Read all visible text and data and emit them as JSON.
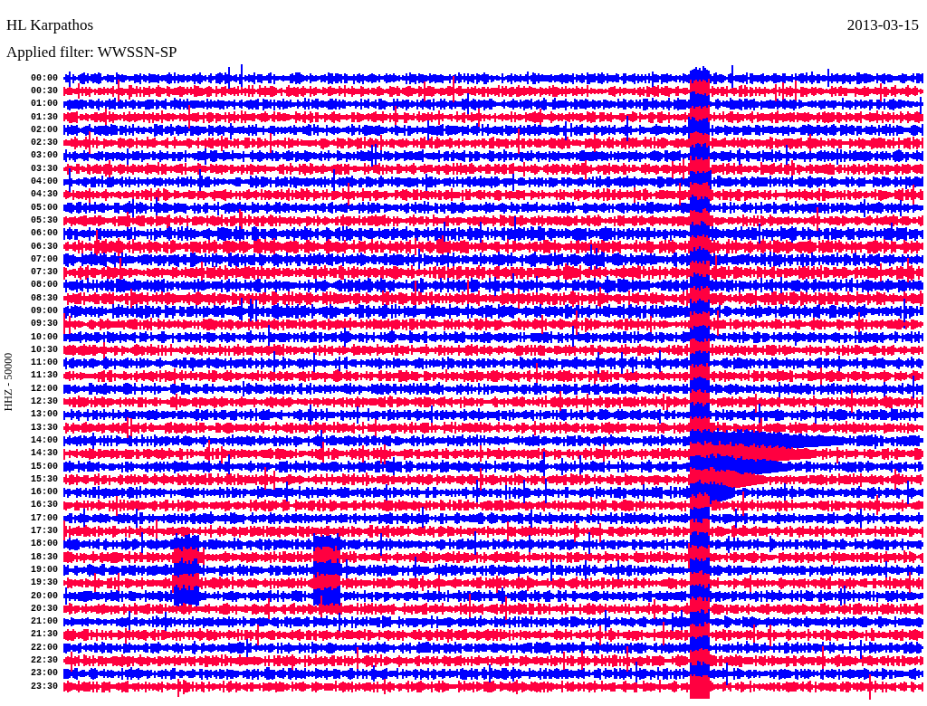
{
  "header": {
    "station": "HL Karpathos",
    "date": "2013-03-15",
    "filter": "Applied filter: WWSSN-SP"
  },
  "axis_label": "HHZ - 50000",
  "rows": [
    {
      "time": "00:00",
      "color": "#0000ff"
    },
    {
      "time": "00:30",
      "color": "#ff0040"
    },
    {
      "time": "01:00",
      "color": "#0000ff"
    },
    {
      "time": "01:30",
      "color": "#ff0040"
    },
    {
      "time": "02:00",
      "color": "#0000ff"
    },
    {
      "time": "02:30",
      "color": "#ff0040"
    },
    {
      "time": "03:00",
      "color": "#0000ff"
    },
    {
      "time": "03:30",
      "color": "#ff0040"
    },
    {
      "time": "04:00",
      "color": "#0000ff"
    },
    {
      "time": "04:30",
      "color": "#ff0040"
    },
    {
      "time": "05:00",
      "color": "#0000ff"
    },
    {
      "time": "05:30",
      "color": "#ff0040"
    },
    {
      "time": "06:00",
      "color": "#0000ff"
    },
    {
      "time": "06:30",
      "color": "#ff0040"
    },
    {
      "time": "07:00",
      "color": "#0000ff"
    },
    {
      "time": "07:30",
      "color": "#ff0040"
    },
    {
      "time": "08:00",
      "color": "#0000ff"
    },
    {
      "time": "08:30",
      "color": "#ff0040"
    },
    {
      "time": "09:00",
      "color": "#0000ff"
    },
    {
      "time": "09:30",
      "color": "#ff0040"
    },
    {
      "time": "10:00",
      "color": "#0000ff"
    },
    {
      "time": "10:30",
      "color": "#ff0040"
    },
    {
      "time": "11:00",
      "color": "#0000ff"
    },
    {
      "time": "11:30",
      "color": "#ff0040"
    },
    {
      "time": "12:00",
      "color": "#0000ff"
    },
    {
      "time": "12:30",
      "color": "#ff0040"
    },
    {
      "time": "13:00",
      "color": "#0000ff"
    },
    {
      "time": "13:30",
      "color": "#ff0040"
    },
    {
      "time": "14:00",
      "color": "#0000ff"
    },
    {
      "time": "14:30",
      "color": "#ff0040"
    },
    {
      "time": "15:00",
      "color": "#0000ff"
    },
    {
      "time": "15:30",
      "color": "#ff0040"
    },
    {
      "time": "16:00",
      "color": "#0000ff"
    },
    {
      "time": "16:30",
      "color": "#ff0040"
    },
    {
      "time": "17:00",
      "color": "#0000ff"
    },
    {
      "time": "17:30",
      "color": "#ff0040"
    },
    {
      "time": "18:00",
      "color": "#0000ff"
    },
    {
      "time": "18:30",
      "color": "#ff0040"
    },
    {
      "time": "19:00",
      "color": "#0000ff"
    },
    {
      "time": "19:30",
      "color": "#ff0040"
    },
    {
      "time": "20:00",
      "color": "#0000ff"
    },
    {
      "time": "20:30",
      "color": "#ff0040"
    },
    {
      "time": "21:00",
      "color": "#0000ff"
    },
    {
      "time": "21:30",
      "color": "#ff0040"
    },
    {
      "time": "22:00",
      "color": "#0000ff"
    },
    {
      "time": "22:30",
      "color": "#ff0040"
    },
    {
      "time": "23:00",
      "color": "#0000ff"
    },
    {
      "time": "23:30",
      "color": "#ff0040"
    }
  ]
}
